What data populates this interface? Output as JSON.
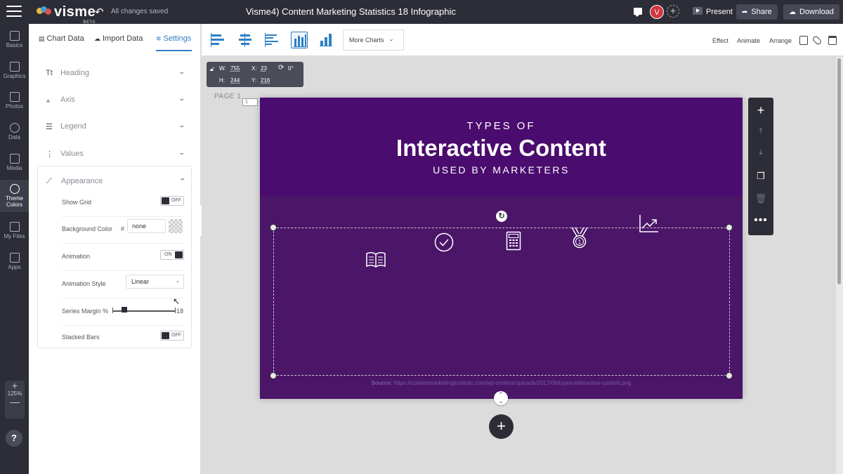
{
  "topbar": {
    "logo": "visme",
    "logo_badge": "BETA",
    "save_status": "All changes saved",
    "doc_title": "Visme4) Content Marketing Statistics 18 Infographic",
    "avatar_initial": "V",
    "present_label": "Present",
    "share_label": "Share",
    "download_label": "Download"
  },
  "leftnav": {
    "items": [
      {
        "label": "Basics",
        "icon": "basics-icon"
      },
      {
        "label": "Graphics",
        "icon": "graphics-icon"
      },
      {
        "label": "Photos",
        "icon": "photos-icon"
      },
      {
        "label": "Data",
        "icon": "data-icon"
      },
      {
        "label": "Media",
        "icon": "media-icon"
      },
      {
        "label": "Theme Colors",
        "icon": "palette-icon"
      },
      {
        "label": "My Files",
        "icon": "upload-icon"
      },
      {
        "label": "Apps",
        "icon": "apps-icon"
      }
    ],
    "zoom": "125%",
    "help": "?"
  },
  "panel": {
    "tabs": [
      "Chart Data",
      "Import Data",
      "Settings"
    ],
    "active_tab": "Settings",
    "sections": [
      "Heading",
      "Axis",
      "Legend",
      "Values",
      "Appearance"
    ],
    "appearance": {
      "show_grid_label": "Show Grid",
      "show_grid_state": "OFF",
      "bg_color_label": "Background Color",
      "bg_color_hash": "#",
      "bg_color_value": "none",
      "animation_label": "Animation",
      "animation_state": "ON",
      "animation_style_label": "Animation Style",
      "animation_style_value": "Linear",
      "series_margin_label": "Series Margin %",
      "series_margin_value": "18",
      "stacked_bars_label": "Stacked Bars",
      "stacked_bars_state": "OFF"
    }
  },
  "toolbar": {
    "chart_types": [
      "stacked-horizontal-bar-icon",
      "diverging-bar-icon",
      "grouped-horizontal-bar-icon",
      "column-chart-icon",
      "stacked-column-icon"
    ],
    "active_chart_type": "column-chart-icon",
    "more_charts_label": "More Charts",
    "effect_label": "Effect",
    "animate_label": "Animate",
    "arrange_label": "Arrange"
  },
  "dimensions": {
    "w_label": "W:",
    "w": "755",
    "x_label": "X:",
    "x": "23",
    "rotation": "0°",
    "h_label": "H:",
    "h": "244",
    "y_label": "Y:",
    "y": "216"
  },
  "page": {
    "label": "PAGE 1",
    "number": "1"
  },
  "slide": {
    "subtitle_top": "TYPES OF",
    "title": "Interactive Content",
    "subtitle_bottom": "USED BY MARKETERS",
    "source_label": "Source:",
    "source_url": "https://contentmarketinginstitute.com/wp-content/uploads/2017/06/types-interactive-content.png",
    "icons": [
      "open-book-icon",
      "checkmark-circle-icon",
      "calculator-icon",
      "medal-icon",
      "trending-up-icon"
    ]
  },
  "colors": {
    "accent": "#2f7fc5",
    "dark_ui": "#2c2d36",
    "slide_header": "#4a0c6e",
    "slide_body": "#4b1568"
  }
}
